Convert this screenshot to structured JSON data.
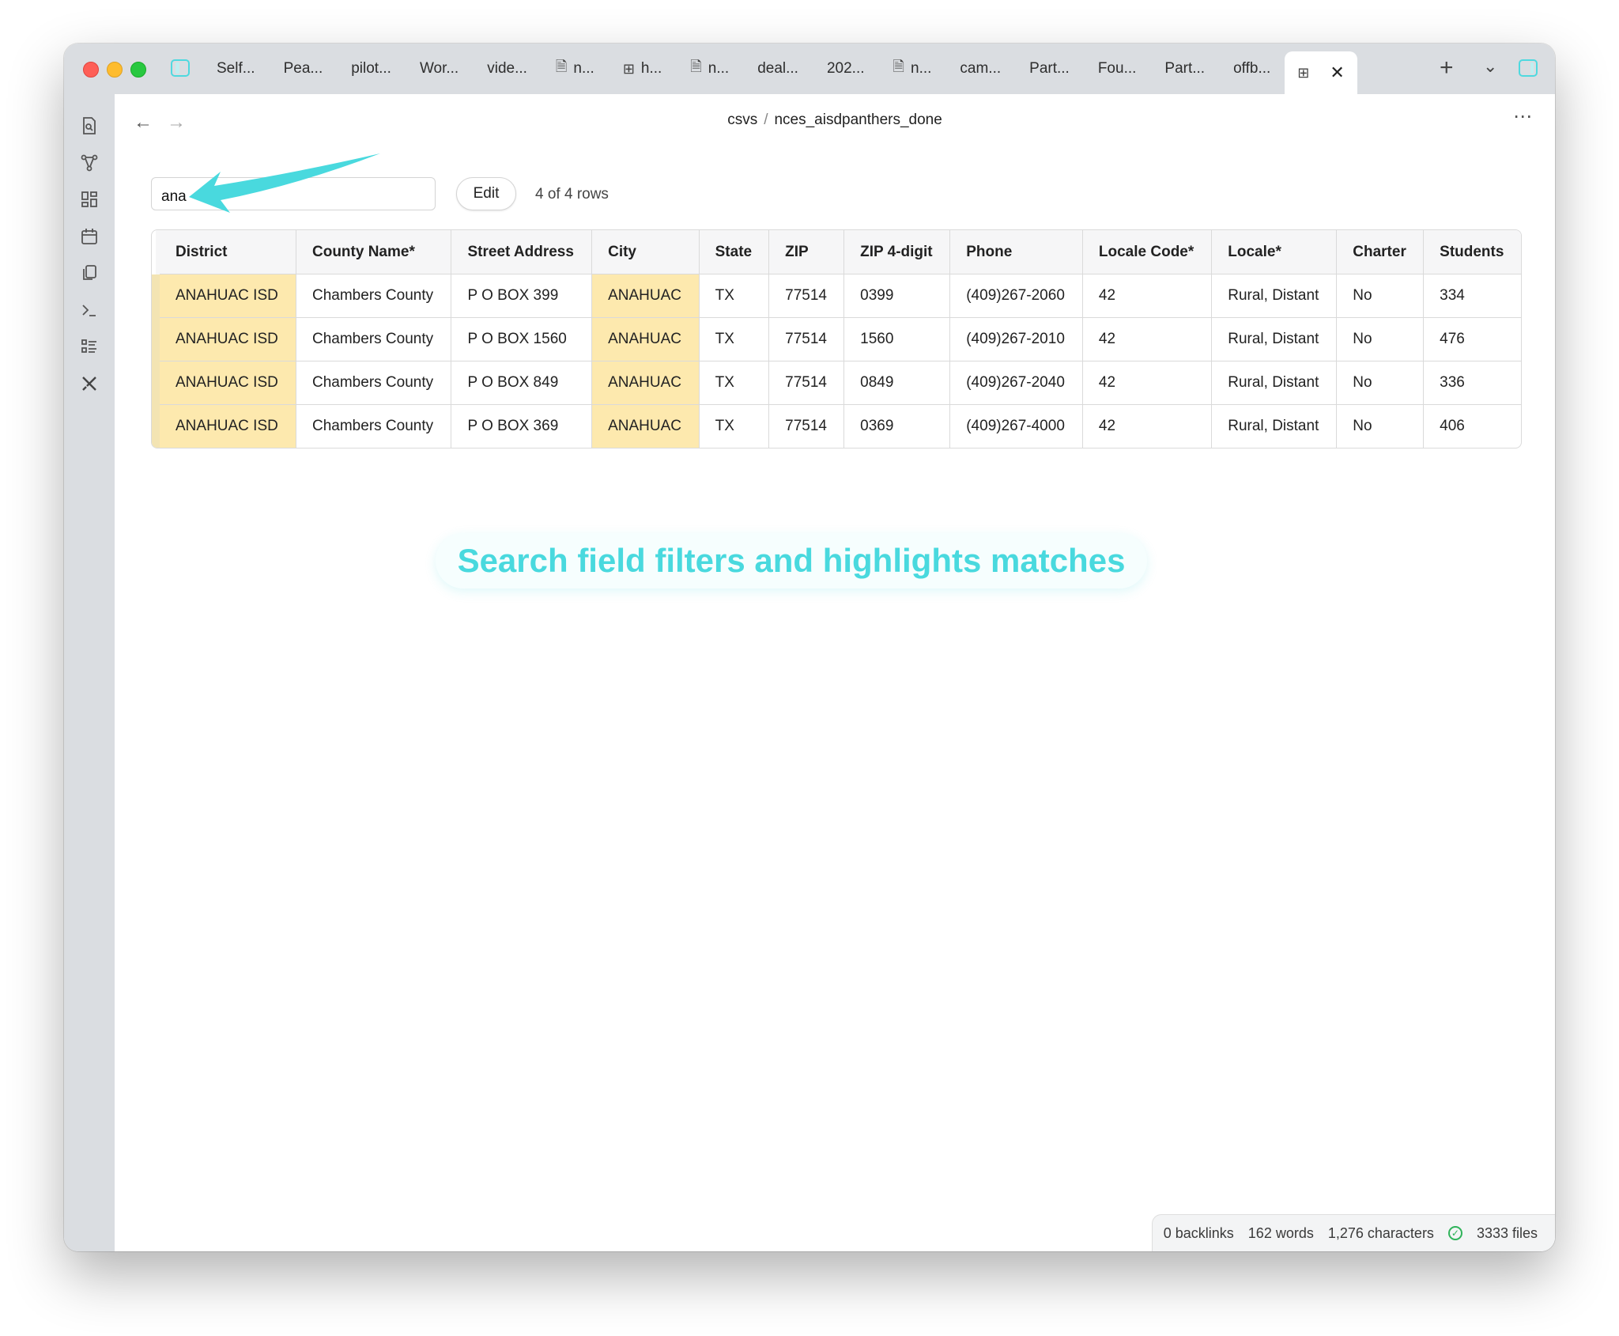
{
  "tabs": [
    {
      "label": "Self...",
      "icon": ""
    },
    {
      "label": "Pea...",
      "icon": ""
    },
    {
      "label": "pilot...",
      "icon": ""
    },
    {
      "label": "Wor...",
      "icon": ""
    },
    {
      "label": "vide...",
      "icon": ""
    },
    {
      "label": "n...",
      "icon": "file-icon"
    },
    {
      "label": "h...",
      "icon": "table-icon"
    },
    {
      "label": "n...",
      "icon": "file-icon"
    },
    {
      "label": "deal...",
      "icon": ""
    },
    {
      "label": "202...",
      "icon": ""
    },
    {
      "label": "n...",
      "icon": "file-icon"
    },
    {
      "label": "cam...",
      "icon": ""
    },
    {
      "label": "Part...",
      "icon": ""
    },
    {
      "label": "Fou...",
      "icon": ""
    },
    {
      "label": "Part...",
      "icon": ""
    },
    {
      "label": "offb...",
      "icon": ""
    }
  ],
  "breadcrumb": {
    "folder": "csvs",
    "separator": "/",
    "file": "nces_aisdpanthers_done"
  },
  "search": {
    "value": "ana"
  },
  "edit_label": "Edit",
  "row_count": "4 of 4 rows",
  "table": {
    "headers": [
      "District",
      "County Name*",
      "Street Address",
      "City",
      "State",
      "ZIP",
      "ZIP 4-digit",
      "Phone",
      "Locale Code*",
      "Locale*",
      "Charter",
      "Students"
    ],
    "rows": [
      [
        "ANAHUAC ISD",
        "Chambers County",
        "P O BOX 399",
        "ANAHUAC",
        "TX",
        "77514",
        "0399",
        "(409)267-2060",
        "42",
        "Rural, Distant",
        "No",
        "334"
      ],
      [
        "ANAHUAC ISD",
        "Chambers County",
        "P O BOX 1560",
        "ANAHUAC",
        "TX",
        "77514",
        "1560",
        "(409)267-2010",
        "42",
        "Rural, Distant",
        "No",
        "476"
      ],
      [
        "ANAHUAC ISD",
        "Chambers County",
        "P O BOX 849",
        "ANAHUAC",
        "TX",
        "77514",
        "0849",
        "(409)267-2040",
        "42",
        "Rural, Distant",
        "No",
        "336"
      ],
      [
        "ANAHUAC ISD",
        "Chambers County",
        "P O BOX 369",
        "ANAHUAC",
        "TX",
        "77514",
        "0369",
        "(409)267-4000",
        "42",
        "Rural, Distant",
        "No",
        "406"
      ]
    ]
  },
  "callout": "Search field filters and highlights matches",
  "status": {
    "backlinks": "0 backlinks",
    "words": "162 words",
    "characters": "1,276 characters",
    "files": "3333 files"
  },
  "colors": {
    "accent": "#4ed9df",
    "highlight": "#fde9ae"
  }
}
